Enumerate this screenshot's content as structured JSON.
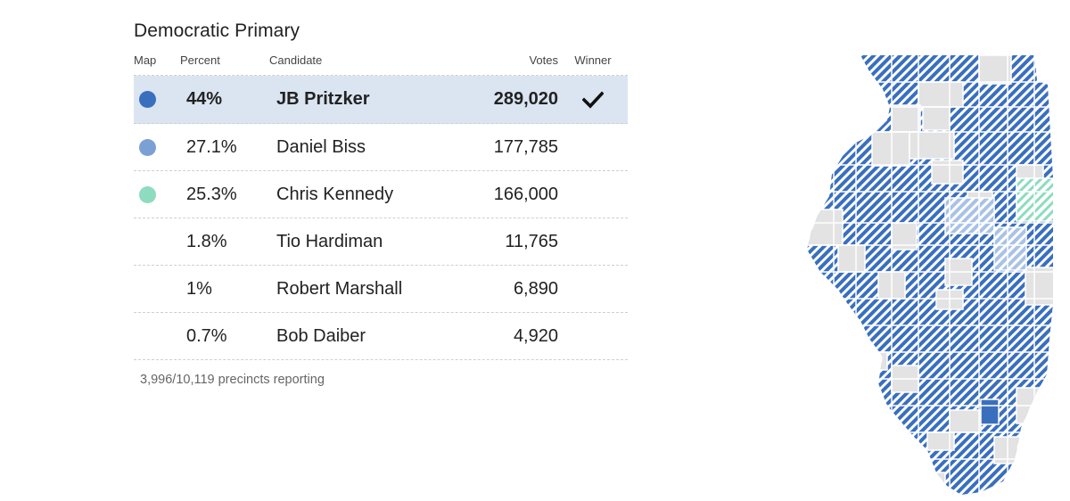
{
  "race": {
    "title": "Democratic Primary",
    "headers": {
      "map": "Map",
      "percent": "Percent",
      "candidate": "Candidate",
      "votes": "Votes",
      "winner": "Winner"
    },
    "candidates": [
      {
        "name": "JB Pritzker",
        "percent": "44%",
        "votes": "289,020",
        "color": "#3a6fbe",
        "winner": true
      },
      {
        "name": "Daniel Biss",
        "percent": "27.1%",
        "votes": "177,785",
        "color": "#7ba1d4",
        "winner": false
      },
      {
        "name": "Chris Kennedy",
        "percent": "25.3%",
        "votes": "166,000",
        "color": "#8ddcbf",
        "winner": false
      },
      {
        "name": "Tio Hardiman",
        "percent": "1.8%",
        "votes": "11,765",
        "color": null,
        "winner": false
      },
      {
        "name": "Robert Marshall",
        "percent": "1%",
        "votes": "6,890",
        "color": null,
        "winner": false
      },
      {
        "name": "Bob Daiber",
        "percent": "0.7%",
        "votes": "4,920",
        "color": null,
        "winner": false
      }
    ],
    "precincts_reporting": "3,996/10,119 precincts reporting"
  },
  "map": {
    "legend_colors": {
      "pritzker_solid": "#3a6fbe",
      "pritzker_hatch": "#3a6fbe",
      "biss_hatch": "#a9c2e6",
      "kennedy_hatch": "#8ddcbf",
      "no_results": "#e3e3e3",
      "border": "#ffffff"
    }
  }
}
